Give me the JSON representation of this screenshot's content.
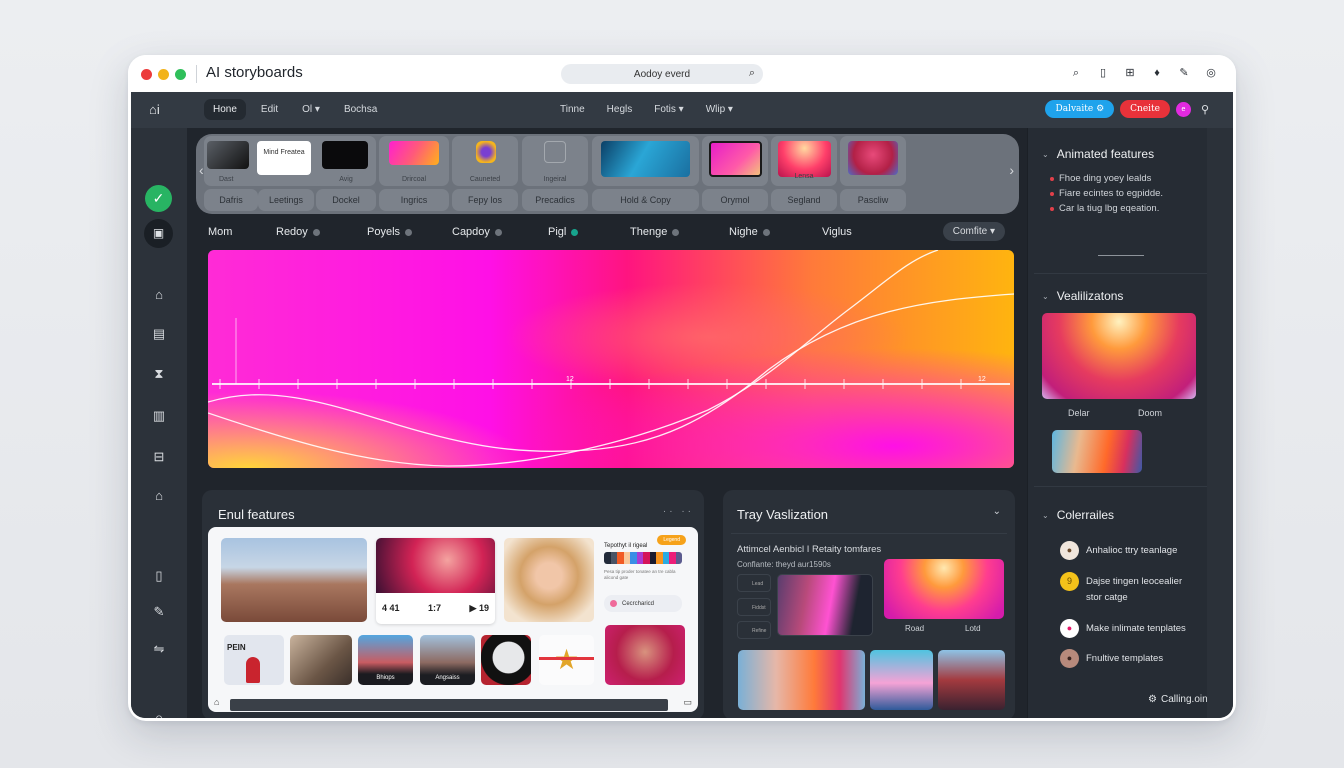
{
  "window": {
    "title": "AI storyboards",
    "address": "Aodoy everd",
    "titlebar_icons": [
      "search-icon",
      "book-icon",
      "grid-icon",
      "bell-icon",
      "pen-icon",
      "settings-icon"
    ]
  },
  "topnav": {
    "left_items": [
      {
        "label": "Hone",
        "active": true
      },
      {
        "label": "Edit",
        "active": false
      },
      {
        "label": "Ol ▾",
        "active": false
      },
      {
        "label": "Bochsa",
        "active": false
      }
    ],
    "mid_items": [
      {
        "label": "Tinne"
      },
      {
        "label": "Hegls"
      },
      {
        "label": "Fotis ▾"
      },
      {
        "label": "Wlip ▾"
      }
    ],
    "primary_button": "Dalvaite",
    "danger_button": "Cneite",
    "avatar_initial": "e"
  },
  "sidebar": {
    "items": [
      "home-icon",
      "gallery-icon",
      "hourglass-icon",
      "layers-icon",
      "folder-icon",
      "house-icon",
      "document-icon",
      "brush-icon",
      "share-icon",
      "library-icon"
    ]
  },
  "carousel": {
    "tiles": [
      {
        "label": "Dast"
      },
      {
        "label": "Mind Freatea"
      },
      {
        "label": "Avig"
      },
      {
        "label": "Drircoal"
      },
      {
        "label": "Cauneted"
      },
      {
        "label": "Ingeiral"
      },
      {
        "label": ""
      },
      {
        "label": ""
      },
      {
        "label": "Lensa"
      },
      {
        "label": ""
      }
    ],
    "captions": [
      "Dafris",
      "Leetings",
      "Dockel",
      "Ingrics",
      "Fepy los",
      "Precadics",
      "Hold & Copy",
      "Orymol",
      "Segland",
      "Pascliw"
    ]
  },
  "tabs": [
    {
      "label": "Mom",
      "dot": null
    },
    {
      "label": "Redoy",
      "dot": "gray"
    },
    {
      "label": "Poyels",
      "dot": "gray"
    },
    {
      "label": "Capdoy",
      "dot": "gray"
    },
    {
      "label": "Pigl",
      "dot": "teal"
    },
    {
      "label": "Thenge",
      "dot": "gray"
    },
    {
      "label": "Nighe",
      "dot": "gray"
    },
    {
      "label": "Viglus",
      "dot": null
    }
  ],
  "combo": {
    "value": "Comfite ▾"
  },
  "hero": {
    "axis_labels": [
      "12",
      "12"
    ]
  },
  "features_panel": {
    "title": "Enul features",
    "player": {
      "left": "4 41",
      "center": "1:7",
      "right": "▶ 19"
    },
    "palette_title": "Tepothyt il rigeal",
    "badge": "Legend",
    "palette_colors": [
      "#222b3a",
      "#4a5466",
      "#f15a24",
      "#f9c89b",
      "#3a8ee6",
      "#a93bd3",
      "#d4145a",
      "#1b1b2f",
      "#f7931e",
      "#29abe2",
      "#ed1e79",
      "#5b5b8f"
    ],
    "palette_text": "Pesa tip proder tonatee an tre cabla alicond gate",
    "action_label": "Cecrcharicd",
    "strip_labels": [
      "PEIN",
      "",
      "Bhiops",
      "Angsaiss",
      "",
      "",
      ""
    ]
  },
  "viz_panel": {
    "title": "Tray Vaslization",
    "subtitle": "Attimcel Aenbicl I Retaity tomfares",
    "caption": "Conflante: theyd aur1590s",
    "list": [
      "Lead",
      "Fiddst",
      "Refine"
    ],
    "labels": [
      "Road",
      "Lotd"
    ]
  },
  "right_sidebar": {
    "animated": {
      "title": "Animated features",
      "bullets": [
        "Fhoe ding yoey lealds",
        "Fiare ecintes to egpidde.",
        "Car la tiug lbg eqeation."
      ],
      "divider": "ok"
    },
    "visualizations": {
      "title": "Vealilizatons",
      "captions": [
        "Delar",
        "Doom"
      ]
    },
    "collaborators": {
      "title": "Colerrailes",
      "items": [
        {
          "label": "Anhalioc ttry teanlage",
          "avatar": "person",
          "color": "#f0e6dc"
        },
        {
          "label": "Dajse tingen leocealier stor catge",
          "avatar": "9",
          "color": "#f4c21a"
        },
        {
          "label": "Make inlimate tenplates",
          "avatar": "dot",
          "color": "#ffffff"
        },
        {
          "label": "Fnultive templates",
          "avatar": "person",
          "color": "#b78a7c"
        }
      ],
      "footer": "Calling.oin"
    }
  }
}
